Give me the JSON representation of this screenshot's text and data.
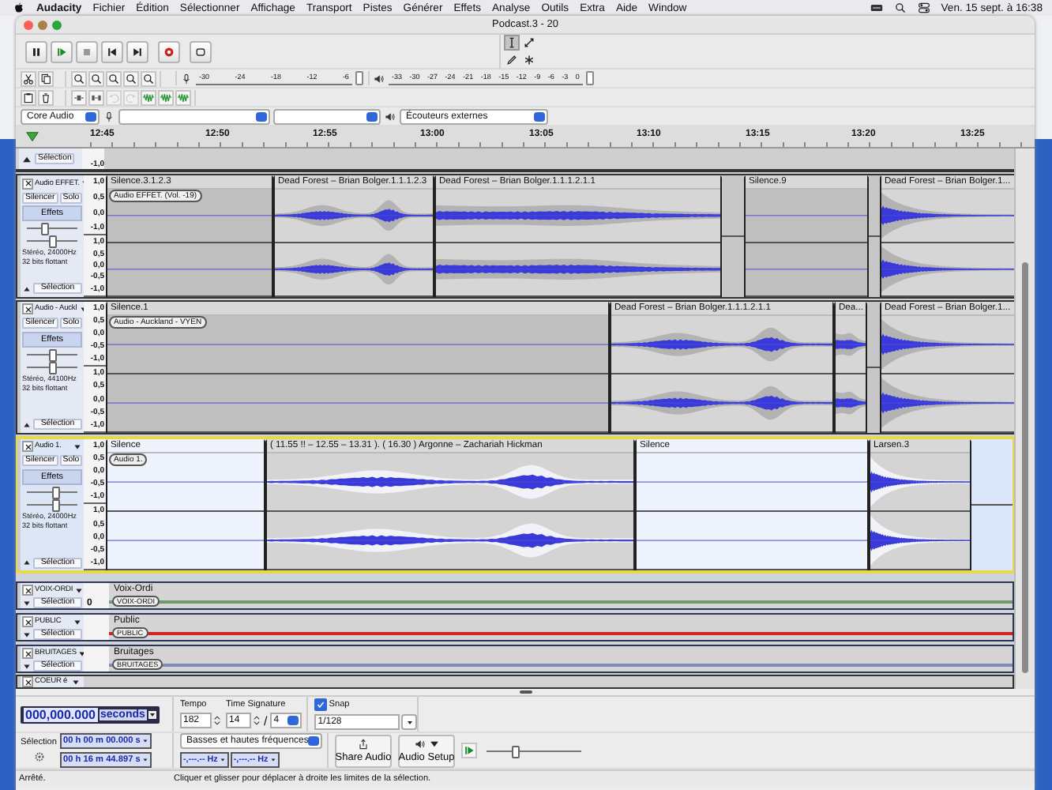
{
  "menubar": {
    "app": "Audacity",
    "items": [
      "Fichier",
      "Édition",
      "Sélectionner",
      "Affichage",
      "Transport",
      "Pistes",
      "Générer",
      "Effets",
      "Analyse",
      "Outils",
      "Extra",
      "Aide",
      "Window"
    ],
    "clock": "Ven. 15 sept. à 16:38"
  },
  "window": {
    "title": "Podcast.3 - 20"
  },
  "tools": [
    {
      "kind": "select",
      "selected": true
    },
    {
      "kind": "envelope",
      "selected": false
    },
    {
      "kind": "draw",
      "selected": false
    },
    {
      "kind": "multi",
      "selected": false
    }
  ],
  "meters": [
    {
      "kind": "record",
      "ticks": [
        "-30",
        "-24",
        "-18",
        "-12",
        "-6"
      ]
    },
    {
      "kind": "play",
      "ticks": [
        "-33",
        "-30",
        "-27",
        "-24",
        "-21",
        "-18",
        "-15",
        "-12",
        "-9",
        "-6",
        "-3",
        "0"
      ]
    }
  ],
  "devices": {
    "host": "Core Audio",
    "output": "Écouteurs externes"
  },
  "ruler": {
    "ticks": [
      "12:45",
      "12:50",
      "12:55",
      "13:00",
      "13:05",
      "13:10",
      "13:15",
      "13:20",
      "13:25"
    ]
  },
  "top_track_tail": {
    "select": "Sélection",
    "tick": "-1,0"
  },
  "tracks": [
    {
      "kind": "audio",
      "name": "Audio EFFET.",
      "selected": false,
      "mute": "Silencer",
      "solo": "Solo",
      "effects": "Effets",
      "gain": {
        "level": 0.35
      },
      "pan": {
        "level": 0.5
      },
      "format": "Stéréo, 24000Hz",
      "depth": "32 bits flottant",
      "select": "Sélection",
      "clip_label": "Audio EFFET. (Vol. -19)",
      "channels": [
        {
          "ticks": [
            "1,0",
            "0,5",
            "0,0",
            "-1,0"
          ]
        },
        {
          "ticks": [
            "1,0",
            "0,5",
            "0,0",
            "-0,5",
            "-1,0"
          ]
        }
      ],
      "clips": [
        {
          "name": "Silence.3.1.2.3",
          "kind": "silence"
        },
        {
          "name": "Dead Forest – Brian Bolger.1.1.1.2.3",
          "kind": "swell"
        },
        {
          "name": "Dead Forest – Brian Bolger.1.1.1.2.1.1",
          "kind": "taper"
        },
        {
          "name": "Silence.9",
          "kind": "silence"
        },
        {
          "name": "Dead Forest – Brian Bolger.1...",
          "kind": "decay"
        }
      ]
    },
    {
      "kind": "audio",
      "name": "Audio - Auckl",
      "selected": false,
      "mute": "Silencer",
      "solo": "Solo",
      "effects": "Effets",
      "gain": {
        "level": 0.5
      },
      "pan": {
        "level": 0.5
      },
      "format": "Stéréo, 44100Hz",
      "depth": "32 bits flottant",
      "select": "Sélection",
      "clip_label": "Audio - Auckland - VYEN",
      "channels": [
        {
          "ticks": [
            "1,0",
            "0,5",
            "0,0",
            "-0,5",
            "-1,0"
          ]
        },
        {
          "ticks": [
            "1,0",
            "0,5",
            "0,0",
            "-0,5",
            "-1,0"
          ]
        }
      ],
      "clips": [
        {
          "name": "Silence.1",
          "kind": "silence"
        },
        {
          "name": "Dead Forest – Brian Bolger.1.1.1.2.1.1",
          "kind": "swell"
        },
        {
          "name": "Dea...",
          "kind": "taper"
        },
        {
          "name": "Dead Forest – Brian Bolger.1...",
          "kind": "decay"
        }
      ]
    },
    {
      "kind": "audio",
      "name": "Audio 1.",
      "selected": true,
      "mute": "Silencer",
      "solo": "Solo",
      "effects": "Effets",
      "gain": {
        "level": 0.55
      },
      "pan": {
        "level": 0.55
      },
      "format": "Stéréo, 24000Hz",
      "depth": "32 bits flottant",
      "select": "Sélection",
      "clip_label": "Audio 1.",
      "channels": [
        {
          "ticks": [
            "1,0",
            "0,5",
            "0,0",
            "-0,5",
            "-1,0"
          ]
        },
        {
          "ticks": [
            "1,0",
            "0,5",
            "0,0",
            "-0,5",
            "-1,0"
          ]
        }
      ],
      "clips": [
        {
          "name": "Silence",
          "kind": "silence"
        },
        {
          "name": "( 11.55 !! – 12.55 – 13.31 ). ( 16.30 )  Argonne – Zachariah Hickman",
          "kind": "swell"
        },
        {
          "name": "Silence",
          "kind": "silence"
        },
        {
          "name": "Larsen.3",
          "kind": "decay"
        }
      ]
    },
    {
      "kind": "label",
      "name": "VOIX-ORDI",
      "select": "Sélection",
      "ruler_text": "0",
      "title": "Voix-Ordi",
      "label": "VOIX-ORDI",
      "color": "#6f9a6f"
    },
    {
      "kind": "label",
      "name": "PUBLIC",
      "select": "Sélection",
      "title": "Public",
      "label": "PUBLIC",
      "color": "#d42222"
    },
    {
      "kind": "label",
      "name": "BRUITAGES",
      "select": "Sélection",
      "title": "Bruitages",
      "label": "BRUITAGES",
      "color": "#7d88bb"
    },
    {
      "kind": "stub",
      "name": "COEUR é"
    }
  ],
  "bottom": {
    "time": {
      "value": "000,000.000",
      "unit": "seconds"
    },
    "tempo_label": "Tempo",
    "tempo": "182",
    "signature_label": "Time Signature",
    "sig_upper": "14",
    "sig_slash": "/",
    "sig_lower": "4",
    "snap": {
      "label": "Snap",
      "checked": true
    },
    "snap_value": "1/128",
    "selection_label": "Sélection",
    "sel_start": "00 h 00 m 00.000 s",
    "sel_end": "00 h 16 m 44.897 s",
    "spectral": "Basses et hautes fréquences",
    "low_hz": "-,---.-- Hz",
    "high_hz": "-,---.-- Hz",
    "share": "Share Audio",
    "setup": "Audio Setup",
    "speed": {
      "level": 0.3
    }
  },
  "status": {
    "state": "Arrêté.",
    "hint": "Cliquer et glisser pour déplacer à droite les limites de la sélection."
  }
}
